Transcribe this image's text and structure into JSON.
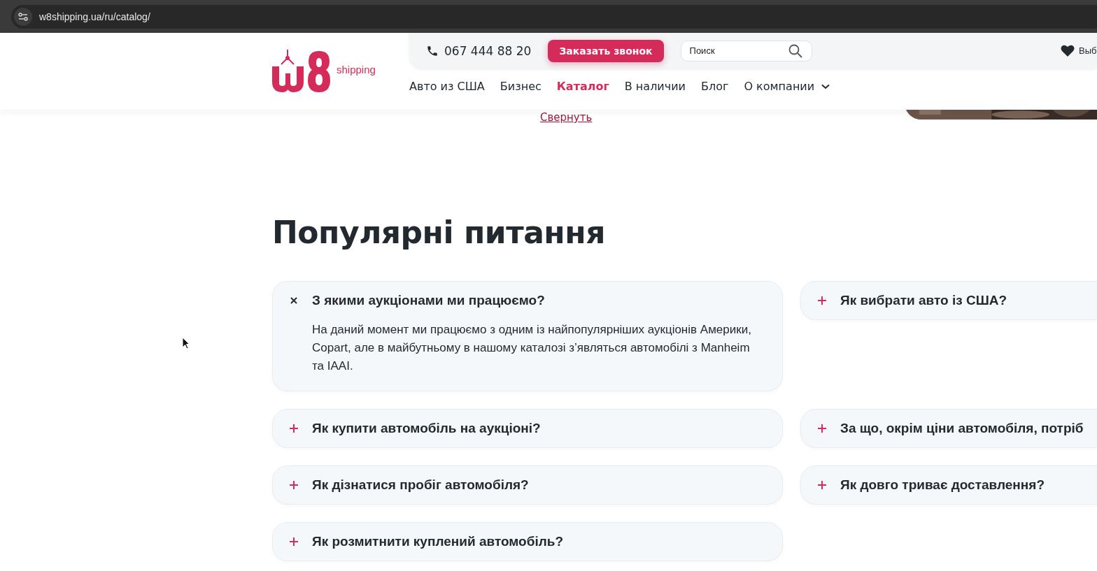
{
  "browser": {
    "url": "w8shipping.ua/ru/catalog/"
  },
  "header": {
    "logo_text": "shipping",
    "phone": "067 444 88 20",
    "callback_button": "Заказать звонок",
    "search": {
      "placeholder": "Поиск"
    },
    "favorites": "Выб",
    "nav": [
      {
        "label": "Авто из США",
        "selected": false,
        "dropdown": false
      },
      {
        "label": "Бизнес",
        "selected": false,
        "dropdown": false
      },
      {
        "label": "Каталог",
        "selected": true,
        "dropdown": false
      },
      {
        "label": "В наличии",
        "selected": false,
        "dropdown": false
      },
      {
        "label": "Блог",
        "selected": false,
        "dropdown": false
      },
      {
        "label": "О компании",
        "selected": false,
        "dropdown": true
      }
    ]
  },
  "collapse_link": "Свернуть",
  "faq": {
    "title": "Популярні питання",
    "rows": [
      [
        {
          "question": "З якими аукціонами ми працюємо?",
          "expanded": true,
          "answer": "На даний момент ми працюємо з одним із найпопулярніших аукціонів Америки, Copart, але в майбутньому в нашому каталозі з’являться автомобілі з Manheim та IAAI."
        },
        {
          "question": "Як вибрати авто із США?",
          "expanded": false
        }
      ],
      [
        {
          "question": "Як купити автомобіль на аукціоні?",
          "expanded": false
        },
        {
          "question": "За що, окрім ціни автомобіля, потріб",
          "expanded": false
        }
      ],
      [
        {
          "question": "Як дізнатися пробіг автомобіля?",
          "expanded": false
        },
        {
          "question": "Як довго триває доставлення?",
          "expanded": false
        }
      ],
      [
        {
          "question": "Як розмитнити куплений автомобіль?",
          "expanded": false
        }
      ]
    ]
  }
}
